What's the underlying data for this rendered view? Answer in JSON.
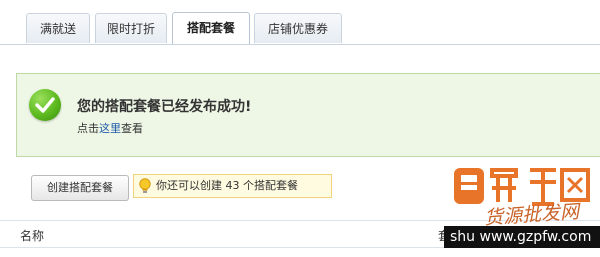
{
  "tabs": [
    {
      "label": "满就送",
      "active": false
    },
    {
      "label": "限时打折",
      "active": false
    },
    {
      "label": "搭配套餐",
      "active": true
    },
    {
      "label": "店铺优惠券",
      "active": false
    }
  ],
  "notice": {
    "title": "您的搭配套餐已经发布成功!",
    "link_prefix": "点击",
    "link_text": "这里",
    "link_suffix": "查看",
    "icon": "check-circle-icon"
  },
  "actions": {
    "create_button_label": "创建搭配套餐"
  },
  "tip": {
    "icon": "lightbulb-icon",
    "text": "你还可以创建  43 个搭配套餐"
  },
  "table": {
    "columns": [
      "名称",
      "套"
    ]
  },
  "watermark": {
    "script_text": "货源批发网",
    "url_text": "shu   www.gzpfw.com"
  },
  "colors": {
    "success_bg": "#eef7e6",
    "success_border": "#bcd9a6",
    "link": "#1d5aa8",
    "tip_bg": "#fffbe0",
    "tip_border": "#f0d37a",
    "check_green": "#5cb91e"
  }
}
